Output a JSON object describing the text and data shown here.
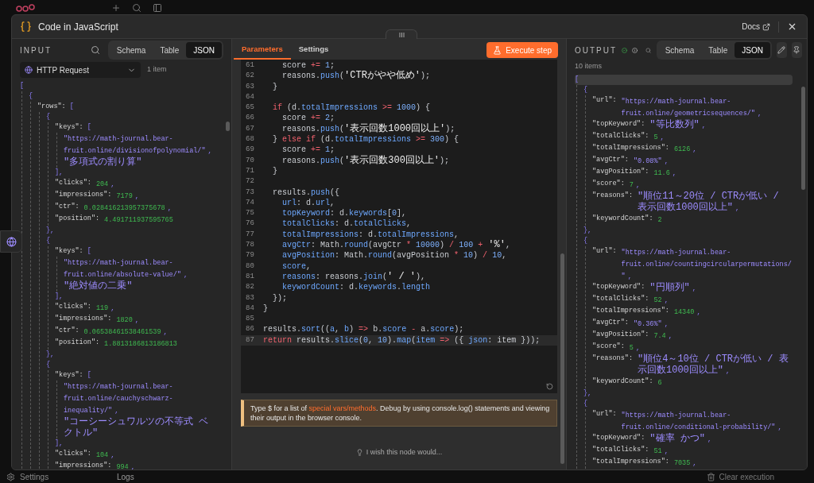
{
  "background": {
    "settings_label": "Settings",
    "logs_tab": "Logs",
    "clear_button": "Clear execution"
  },
  "modal": {
    "title": "Code in JavaScript",
    "docs_link": "Docs"
  },
  "input": {
    "heading": "INPUT",
    "views": [
      {
        "label": "Schema",
        "selected": false
      },
      {
        "label": "Table",
        "selected": false
      },
      {
        "label": "JSON",
        "selected": true
      }
    ],
    "source": "HTTP Request",
    "count": "1 item",
    "json": {
      "open": "[",
      "hovered": false,
      "children": [
        {
          "open": "{",
          "children": [
            {
              "key": "\"rows\":",
              "open": "[",
              "children": [
                {
                  "open": "{",
                  "close": "},",
                  "children": [
                    {
                      "key": "\"keys\":",
                      "open": "[",
                      "close": "],",
                      "children": [
                        {
                          "value": "\"https://math-journal.bear-fruit.online/divisionofpolynomial/\"",
                          "kind": "string",
                          "sep": ","
                        },
                        {
                          "value": "\"多項式の割り算\"",
                          "kind": "jstring"
                        }
                      ]
                    },
                    {
                      "key": "\"clicks\":",
                      "value": "204",
                      "kind": "number",
                      "sep": ","
                    },
                    {
                      "key": "\"impressions\":",
                      "value": "7179",
                      "kind": "number",
                      "sep": ","
                    },
                    {
                      "key": "\"ctr\":",
                      "value": "0.028416213957375678",
                      "kind": "number",
                      "sep": ","
                    },
                    {
                      "key": "\"position\":",
                      "value": "4.491711937595765",
                      "kind": "number"
                    }
                  ]
                },
                {
                  "open": "{",
                  "close": "},",
                  "children": [
                    {
                      "key": "\"keys\":",
                      "open": "[",
                      "close": "],",
                      "children": [
                        {
                          "value": "\"https://math-journal.bear-fruit.online/absolute-value/\"",
                          "kind": "string",
                          "sep": ","
                        },
                        {
                          "value": "\"絶対値の二乗\"",
                          "kind": "jstring"
                        }
                      ]
                    },
                    {
                      "key": "\"clicks\":",
                      "value": "119",
                      "kind": "number",
                      "sep": ","
                    },
                    {
                      "key": "\"impressions\":",
                      "value": "1820",
                      "kind": "number",
                      "sep": ","
                    },
                    {
                      "key": "\"ctr\":",
                      "value": "0.06538461538461539",
                      "kind": "number",
                      "sep": ","
                    },
                    {
                      "key": "\"position\":",
                      "value": "1.8813186813186813",
                      "kind": "number"
                    }
                  ]
                },
                {
                  "open": "{",
                  "children": [
                    {
                      "key": "\"keys\":",
                      "open": "[",
                      "close": "],",
                      "children": [
                        {
                          "value": "\"https://math-journal.bear-fruit.online/cauchyschwarz-inequality/\"",
                          "kind": "string",
                          "sep": ","
                        },
                        {
                          "value": "\"コーシーシュワルツの不等式 ベクトル\"",
                          "kind": "jstring"
                        }
                      ]
                    },
                    {
                      "key": "\"clicks\":",
                      "value": "104",
                      "kind": "number",
                      "sep": ","
                    },
                    {
                      "key": "\"impressions\":",
                      "value": "994",
                      "kind": "number",
                      "sep": ","
                    }
                  ]
                }
              ]
            }
          ]
        }
      ]
    }
  },
  "editor": {
    "tabs": [
      {
        "label": "Parameters",
        "selected": true
      },
      {
        "label": "Settings",
        "selected": false
      }
    ],
    "execute_button": "Execute step",
    "lines": [
      {
        "number": "61",
        "current": false,
        "tokens": [
          {
            "kind": "p",
            "text": "    score "
          },
          {
            "kind": "o",
            "text": "+="
          },
          {
            "kind": "n",
            "text": " 1"
          },
          {
            "kind": "p",
            "text": ";"
          }
        ]
      },
      {
        "number": "62",
        "current": false,
        "tokens": [
          {
            "kind": "p",
            "text": "    reasons."
          },
          {
            "kind": "f",
            "text": "push"
          },
          {
            "kind": "p",
            "text": "("
          },
          {
            "kind": "s",
            "text": "'CTRがやや低め'"
          },
          {
            "kind": "p",
            "text": ");"
          }
        ]
      },
      {
        "number": "63",
        "current": false,
        "tokens": [
          {
            "kind": "p",
            "text": "  }"
          }
        ]
      },
      {
        "number": "64",
        "current": false
      },
      {
        "number": "65",
        "current": false,
        "tokens": [
          {
            "kind": "k",
            "text": "  if"
          },
          {
            "kind": "p",
            "text": " (d."
          },
          {
            "kind": "f",
            "text": "totalImpressions"
          },
          {
            "kind": "o",
            "text": " >="
          },
          {
            "kind": "n",
            "text": " 1000"
          },
          {
            "kind": "p",
            "text": ") {"
          }
        ]
      },
      {
        "number": "66",
        "current": false,
        "tokens": [
          {
            "kind": "p",
            "text": "    score "
          },
          {
            "kind": "o",
            "text": "+="
          },
          {
            "kind": "n",
            "text": " 2"
          },
          {
            "kind": "p",
            "text": ";"
          }
        ]
      },
      {
        "number": "67",
        "current": false,
        "tokens": [
          {
            "kind": "p",
            "text": "    reasons."
          },
          {
            "kind": "f",
            "text": "push"
          },
          {
            "kind": "p",
            "text": "("
          },
          {
            "kind": "s",
            "text": "'表示回数1000回以上'"
          },
          {
            "kind": "p",
            "text": ");"
          }
        ]
      },
      {
        "number": "68",
        "current": false,
        "tokens": [
          {
            "kind": "p",
            "text": "  } "
          },
          {
            "kind": "k",
            "text": "else if"
          },
          {
            "kind": "p",
            "text": " (d."
          },
          {
            "kind": "f",
            "text": "totalImpressions"
          },
          {
            "kind": "o",
            "text": " >="
          },
          {
            "kind": "n",
            "text": " 300"
          },
          {
            "kind": "p",
            "text": ") {"
          }
        ]
      },
      {
        "number": "69",
        "current": false,
        "tokens": [
          {
            "kind": "p",
            "text": "    score "
          },
          {
            "kind": "o",
            "text": "+="
          },
          {
            "kind": "n",
            "text": " 1"
          },
          {
            "kind": "p",
            "text": ";"
          }
        ]
      },
      {
        "number": "70",
        "current": false,
        "tokens": [
          {
            "kind": "p",
            "text": "    reasons."
          },
          {
            "kind": "f",
            "text": "push"
          },
          {
            "kind": "p",
            "text": "("
          },
          {
            "kind": "s",
            "text": "'表示回数300回以上'"
          },
          {
            "kind": "p",
            "text": ");"
          }
        ]
      },
      {
        "number": "71",
        "current": false,
        "tokens": [
          {
            "kind": "p",
            "text": "  }"
          }
        ]
      },
      {
        "number": "72",
        "current": false
      },
      {
        "number": "73",
        "current": false,
        "tokens": [
          {
            "kind": "p",
            "text": "  results."
          },
          {
            "kind": "f",
            "text": "push"
          },
          {
            "kind": "p",
            "text": "({"
          }
        ]
      },
      {
        "number": "74",
        "current": false,
        "tokens": [
          {
            "kind": "f",
            "text": "    url"
          },
          {
            "kind": "p",
            "text": ": d."
          },
          {
            "kind": "f",
            "text": "url"
          },
          {
            "kind": "p",
            "text": ","
          }
        ]
      },
      {
        "number": "75",
        "current": false,
        "tokens": [
          {
            "kind": "f",
            "text": "    topKeyword"
          },
          {
            "kind": "p",
            "text": ": d."
          },
          {
            "kind": "f",
            "text": "keywords"
          },
          {
            "kind": "p",
            "text": "["
          },
          {
            "kind": "n",
            "text": "0"
          },
          {
            "kind": "p",
            "text": "],"
          }
        ]
      },
      {
        "number": "76",
        "current": false,
        "tokens": [
          {
            "kind": "f",
            "text": "    totalClicks"
          },
          {
            "kind": "p",
            "text": ": d."
          },
          {
            "kind": "f",
            "text": "totalClicks"
          },
          {
            "kind": "p",
            "text": ","
          }
        ]
      },
      {
        "number": "77",
        "current": false,
        "tokens": [
          {
            "kind": "f",
            "text": "    totalImpressions"
          },
          {
            "kind": "p",
            "text": ": d."
          },
          {
            "kind": "f",
            "text": "totalImpressions"
          },
          {
            "kind": "p",
            "text": ","
          }
        ]
      },
      {
        "number": "78",
        "current": false,
        "tokens": [
          {
            "kind": "f",
            "text": "    avgCtr"
          },
          {
            "kind": "p",
            "text": ": Math."
          },
          {
            "kind": "f",
            "text": "round"
          },
          {
            "kind": "p",
            "text": "(avgCtr "
          },
          {
            "kind": "o",
            "text": "*"
          },
          {
            "kind": "n",
            "text": " 10000"
          },
          {
            "kind": "p",
            "text": ") "
          },
          {
            "kind": "o",
            "text": "/"
          },
          {
            "kind": "n",
            "text": " 100"
          },
          {
            "kind": "o",
            "text": " +"
          },
          {
            "kind": "s",
            "text": " '%'"
          },
          {
            "kind": "p",
            "text": ","
          }
        ]
      },
      {
        "number": "79",
        "current": false,
        "tokens": [
          {
            "kind": "f",
            "text": "    avgPosition"
          },
          {
            "kind": "p",
            "text": ": Math."
          },
          {
            "kind": "f",
            "text": "round"
          },
          {
            "kind": "p",
            "text": "(avgPosition "
          },
          {
            "kind": "o",
            "text": "*"
          },
          {
            "kind": "n",
            "text": " 10"
          },
          {
            "kind": "p",
            "text": ") "
          },
          {
            "kind": "o",
            "text": "/"
          },
          {
            "kind": "n",
            "text": " 10"
          },
          {
            "kind": "p",
            "text": ","
          }
        ]
      },
      {
        "number": "80",
        "current": false,
        "tokens": [
          {
            "kind": "f",
            "text": "    score"
          },
          {
            "kind": "p",
            "text": ","
          }
        ]
      },
      {
        "number": "81",
        "current": false,
        "tokens": [
          {
            "kind": "f",
            "text": "    reasons"
          },
          {
            "kind": "p",
            "text": ": reasons."
          },
          {
            "kind": "f",
            "text": "join"
          },
          {
            "kind": "p",
            "text": "("
          },
          {
            "kind": "s",
            "text": "' / '"
          },
          {
            "kind": "p",
            "text": "),"
          }
        ]
      },
      {
        "number": "82",
        "current": false,
        "tokens": [
          {
            "kind": "f",
            "text": "    keywordCount"
          },
          {
            "kind": "p",
            "text": ": d."
          },
          {
            "kind": "f",
            "text": "keywords"
          },
          {
            "kind": "p",
            "text": "."
          },
          {
            "kind": "f",
            "text": "length"
          }
        ]
      },
      {
        "number": "83",
        "current": false,
        "tokens": [
          {
            "kind": "p",
            "text": "  });"
          }
        ]
      },
      {
        "number": "84",
        "current": false,
        "tokens": [
          {
            "kind": "p",
            "text": "}"
          }
        ]
      },
      {
        "number": "85",
        "current": false
      },
      {
        "number": "86",
        "current": false,
        "tokens": [
          {
            "kind": "p",
            "text": "results."
          },
          {
            "kind": "f",
            "text": "sort"
          },
          {
            "kind": "p",
            "text": "(("
          },
          {
            "kind": "f",
            "text": "a"
          },
          {
            "kind": "p",
            "text": ", "
          },
          {
            "kind": "f",
            "text": "b"
          },
          {
            "kind": "p",
            "text": ") "
          },
          {
            "kind": "o",
            "text": "=>"
          },
          {
            "kind": "p",
            "text": " b."
          },
          {
            "kind": "f",
            "text": "score"
          },
          {
            "kind": "o",
            "text": " -"
          },
          {
            "kind": "p",
            "text": " a."
          },
          {
            "kind": "f",
            "text": "score"
          },
          {
            "kind": "p",
            "text": ");"
          }
        ]
      },
      {
        "number": "87",
        "current": true,
        "tokens": [
          {
            "kind": "k",
            "text": "return"
          },
          {
            "kind": "p",
            "text": " results."
          },
          {
            "kind": "f",
            "text": "slice"
          },
          {
            "kind": "p",
            "text": "("
          },
          {
            "kind": "n",
            "text": "0"
          },
          {
            "kind": "p",
            "text": ", "
          },
          {
            "kind": "n",
            "text": "10"
          },
          {
            "kind": "p",
            "text": ")."
          },
          {
            "kind": "f",
            "text": "map"
          },
          {
            "kind": "p",
            "text": "("
          },
          {
            "kind": "f",
            "text": "item"
          },
          {
            "kind": "o",
            "text": " =>"
          },
          {
            "kind": "p",
            "text": " ({ "
          },
          {
            "kind": "f",
            "text": "json"
          },
          {
            "kind": "p",
            "text": ": item }));"
          }
        ]
      }
    ],
    "hint": "Type $ for a list of ",
    "hint_link": "special vars/methods",
    "hint_rest": ". Debug by using console.log() statements and viewing their output in the browser console.",
    "feedback": "I wish this node would..."
  },
  "output": {
    "heading": "OUTPUT",
    "views": [
      {
        "label": "Schema",
        "selected": false
      },
      {
        "label": "Table",
        "selected": false
      },
      {
        "label": "JSON",
        "selected": true
      }
    ],
    "count": "10 items",
    "json": {
      "open": "[",
      "hovered": true,
      "children": [
        {
          "open": "{",
          "close": "},",
          "children": [
            {
              "key": "\"url\":",
              "value": "\"https://math-journal.bear-fruit.online/geometricsequences/\"",
              "kind": "string",
              "sep": ","
            },
            {
              "key": "\"topKeyword\":",
              "value": "\"等比数列\"",
              "kind": "jstring",
              "sep": ","
            },
            {
              "key": "\"totalClicks\":",
              "value": "5",
              "kind": "number",
              "sep": ","
            },
            {
              "key": "\"totalImpressions\":",
              "value": "6126",
              "kind": "number",
              "sep": ","
            },
            {
              "key": "\"avgCtr\":",
              "value": "\"0.08%\"",
              "kind": "string",
              "sep": ","
            },
            {
              "key": "\"avgPosition\":",
              "value": "11.6",
              "kind": "number",
              "sep": ","
            },
            {
              "key": "\"score\":",
              "value": "7",
              "kind": "number",
              "sep": ","
            },
            {
              "key": "\"reasons\":",
              "value": "\"順位11～20位 / CTRが低い / 表示回数1000回以上\"",
              "kind": "jstring",
              "sep": ","
            },
            {
              "key": "\"keywordCount\":",
              "value": "2",
              "kind": "number"
            }
          ]
        },
        {
          "open": "{",
          "close": "},",
          "children": [
            {
              "key": "\"url\":",
              "value": "\"https://math-journal.bear-fruit.online/countingcircularpermutations/\"",
              "kind": "string",
              "sep": ","
            },
            {
              "key": "\"topKeyword\":",
              "value": "\"円順列\"",
              "kind": "jstring",
              "sep": ","
            },
            {
              "key": "\"totalClicks\":",
              "value": "52",
              "kind": "number",
              "sep": ","
            },
            {
              "key": "\"totalImpressions\":",
              "value": "14340",
              "kind": "number",
              "sep": ","
            },
            {
              "key": "\"avgCtr\":",
              "value": "\"0.36%\"",
              "kind": "string",
              "sep": ","
            },
            {
              "key": "\"avgPosition\":",
              "value": "7.4",
              "kind": "number",
              "sep": ","
            },
            {
              "key": "\"score\":",
              "value": "5",
              "kind": "number",
              "sep": ","
            },
            {
              "key": "\"reasons\":",
              "value": "\"順位4～10位 / CTRが低い / 表示回数1000回以上\"",
              "kind": "jstring",
              "sep": ","
            },
            {
              "key": "\"keywordCount\":",
              "value": "6",
              "kind": "number"
            }
          ]
        },
        {
          "open": "{",
          "children": [
            {
              "key": "\"url\":",
              "value": "\"https://math-journal.bear-fruit.online/conditional-probability/\"",
              "kind": "string",
              "sep": ","
            },
            {
              "key": "\"topKeyword\":",
              "value": "\"確率 かつ\"",
              "kind": "jstring",
              "sep": ","
            },
            {
              "key": "\"totalClicks\":",
              "value": "51",
              "kind": "number",
              "sep": ","
            },
            {
              "key": "\"totalImpressions\":",
              "value": "7035",
              "kind": "number",
              "sep": ","
            }
          ]
        }
      ]
    }
  }
}
